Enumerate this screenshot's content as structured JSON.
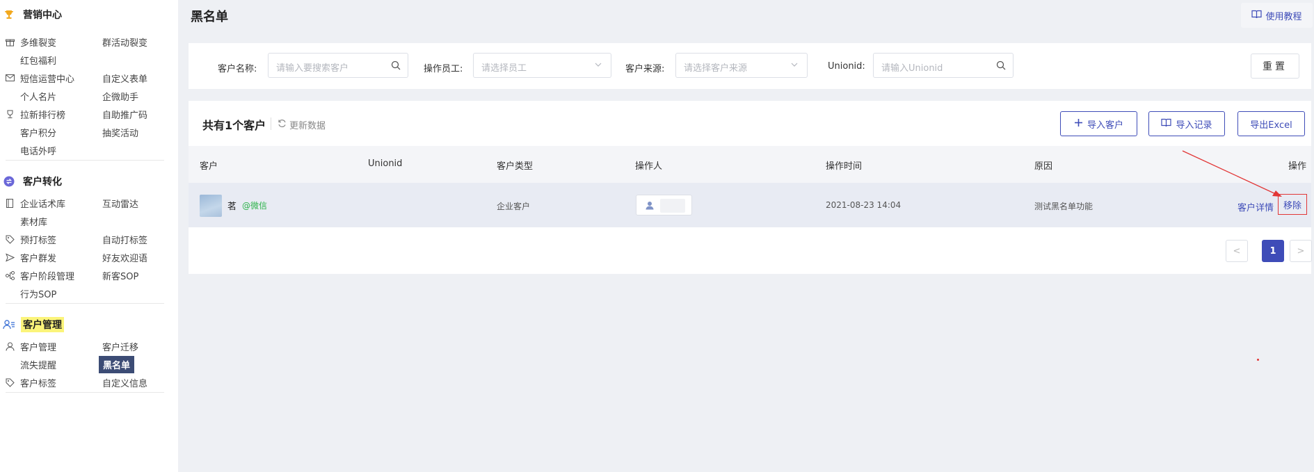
{
  "sidebar": {
    "sections": [
      {
        "title": "营销中心",
        "icon": "trophy-icon",
        "rows": [
          {
            "icon": "gift-icon",
            "left": "多维裂变",
            "right": "群活动裂变"
          },
          {
            "icon": "",
            "left": "红包福利",
            "right": ""
          },
          {
            "icon": "mail-icon",
            "left": "短信运营中心",
            "right": "自定义表单"
          },
          {
            "icon": "",
            "left": "个人名片",
            "right": "企微助手"
          },
          {
            "icon": "cup-icon",
            "left": "拉新排行榜",
            "right": "自助推广码"
          },
          {
            "icon": "",
            "left": "客户积分",
            "right": "抽奖活动"
          },
          {
            "icon": "",
            "left": "电话外呼",
            "right": ""
          }
        ]
      },
      {
        "title": "客户转化",
        "icon": "convert-icon",
        "rows": [
          {
            "icon": "doc-icon",
            "left": "企业话术库",
            "right": "互动雷达"
          },
          {
            "icon": "",
            "left": "素材库",
            "right": ""
          },
          {
            "icon": "tag-icon",
            "left": "预打标签",
            "right": "自动打标签"
          },
          {
            "icon": "send-icon",
            "left": "客户群发",
            "right": "好友欢迎语"
          },
          {
            "icon": "flow-icon",
            "left": "客户阶段管理",
            "right": "新客SOP"
          },
          {
            "icon": "",
            "left": "行为SOP",
            "right": ""
          }
        ]
      },
      {
        "title": "客户管理",
        "icon": "users-icon",
        "rows": [
          {
            "icon": "user-icon",
            "left": "客户管理",
            "right": "客户迁移"
          },
          {
            "icon": "",
            "left": "流失提醒",
            "right": "黑名单"
          },
          {
            "icon": "tag-icon",
            "left": "客户标签",
            "right": "自定义信息"
          }
        ]
      }
    ]
  },
  "header": {
    "title": "黑名单",
    "tutorial_label": "使用教程"
  },
  "filters": {
    "customer_name_label": "客户名称:",
    "customer_name_placeholder": "请输入要搜索客户",
    "operator_label": "操作员工:",
    "operator_placeholder": "请选择员工",
    "source_label": "客户来源:",
    "source_placeholder": "请选择客户来源",
    "unionid_label": "Unionid:",
    "unionid_placeholder": "请输入Unionid",
    "reset_label": "重置"
  },
  "list": {
    "count_text": "共有1个客户",
    "refresh_label": "更新数据",
    "import_customer_label": "导入客户",
    "import_record_label": "导入记录",
    "export_label": "导出Excel",
    "columns": [
      "客户",
      "Unionid",
      "客户类型",
      "操作人",
      "操作时间",
      "原因",
      "操作"
    ],
    "rows": [
      {
        "name": "茗",
        "source_tag": "@微信",
        "unionid": "",
        "type": "企业客户",
        "time": "2021-08-23 14:04",
        "reason": "测试黑名单功能",
        "action_detail": "客户详情",
        "action_remove": "移除"
      }
    ]
  },
  "pagination": {
    "prev": "<",
    "current": "1",
    "next": ">"
  },
  "colors": {
    "accent": "#3e4cb8",
    "annotation": "#e23636",
    "wechat": "#2db34a",
    "highlight": "#fbf47a",
    "active_nav": "#3c4c75"
  }
}
